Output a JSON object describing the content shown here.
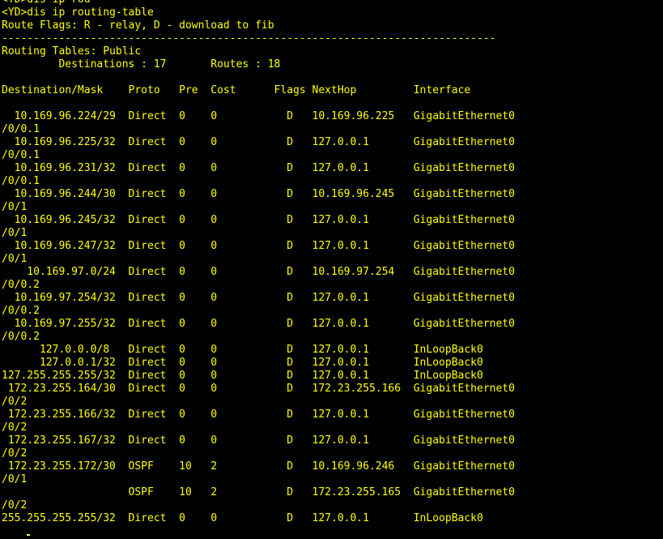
{
  "terminal": {
    "text_color": "#ffff00",
    "background_color": "#000000",
    "lines": [
      "<YD>dis ip rou",
      "<YD>dis ip routing-table",
      "Route Flags: R - relay, D - download to fib",
      "------------------------------------------------------------------------------",
      "Routing Tables: Public",
      "         Destinations : 17       Routes : 18",
      "",
      "Destination/Mask    Proto   Pre  Cost      Flags NextHop         Interface",
      "",
      "  10.169.96.224/29  Direct  0    0           D   10.169.96.225   GigabitEthernet0",
      "/0/0.1",
      "  10.169.96.225/32  Direct  0    0           D   127.0.0.1       GigabitEthernet0",
      "/0/0.1",
      "  10.169.96.231/32  Direct  0    0           D   127.0.0.1       GigabitEthernet0",
      "/0/0.1",
      "  10.169.96.244/30  Direct  0    0           D   10.169.96.245   GigabitEthernet0",
      "/0/1",
      "  10.169.96.245/32  Direct  0    0           D   127.0.0.1       GigabitEthernet0",
      "/0/1",
      "  10.169.96.247/32  Direct  0    0           D   127.0.0.1       GigabitEthernet0",
      "/0/1",
      "    10.169.97.0/24  Direct  0    0           D   10.169.97.254   GigabitEthernet0",
      "/0/0.2",
      "  10.169.97.254/32  Direct  0    0           D   127.0.0.1       GigabitEthernet0",
      "/0/0.2",
      "  10.169.97.255/32  Direct  0    0           D   127.0.0.1       GigabitEthernet0",
      "/0/0.2",
      "      127.0.0.0/8   Direct  0    0           D   127.0.0.1       InLoopBack0",
      "      127.0.0.1/32  Direct  0    0           D   127.0.0.1       InLoopBack0",
      "127.255.255.255/32  Direct  0    0           D   127.0.0.1       InLoopBack0",
      " 172.23.255.164/30  Direct  0    0           D   172.23.255.166  GigabitEthernet0",
      "/0/2",
      " 172.23.255.166/32  Direct  0    0           D   127.0.0.1       GigabitEthernet0",
      "/0/2",
      " 172.23.255.167/32  Direct  0    0           D   127.0.0.1       GigabitEthernet0",
      "/0/2",
      " 172.23.255.172/30  OSPF    10   2           D   10.169.96.246   GigabitEthernet0",
      "/0/1",
      "                    OSPF    10   2           D   172.23.255.165  GigabitEthernet0",
      "/0/2",
      "255.255.255.255/32  Direct  0    0           D   127.0.0.1       InLoopBack0"
    ]
  }
}
